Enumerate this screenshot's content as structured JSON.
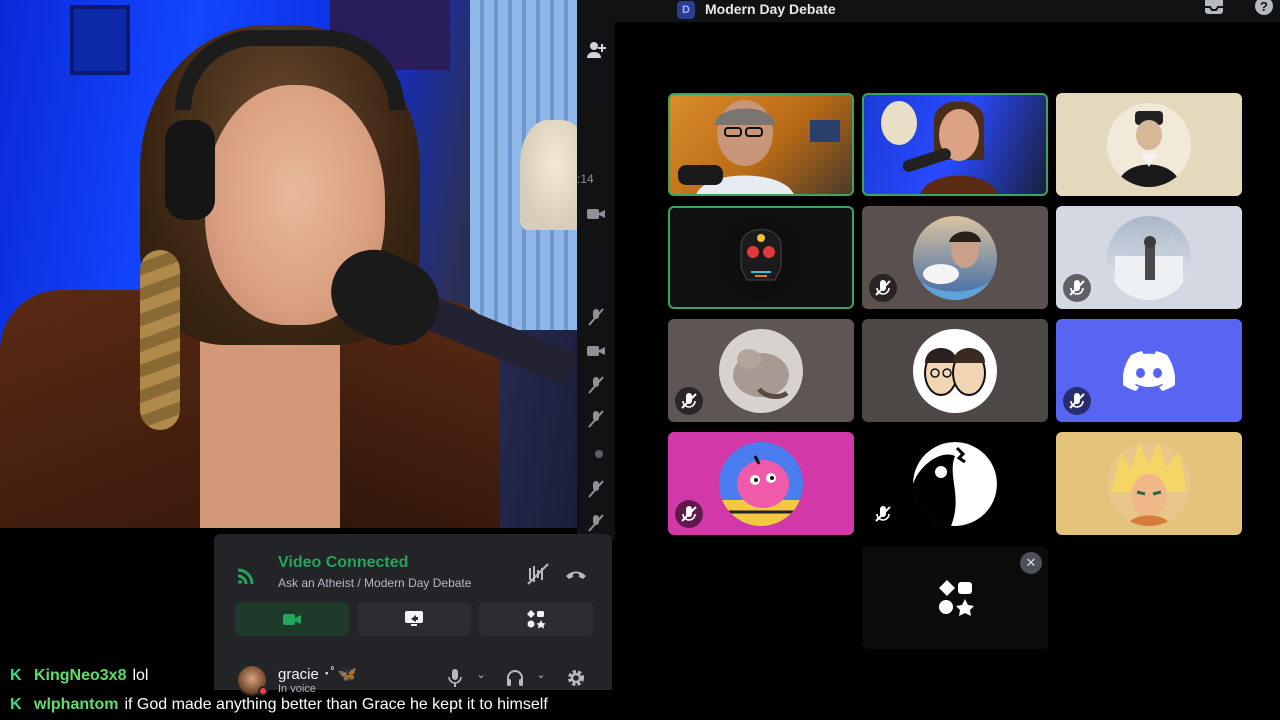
{
  "topbar": {
    "channel_title": "Modern Day Debate",
    "channel_icon": "server-logo-icon",
    "icons": [
      "inbox-icon",
      "help-icon"
    ]
  },
  "rail": {
    "time_fragment": ":14",
    "icons": [
      "add-friend-icon",
      "camera-icon",
      "mic-muted-icon"
    ]
  },
  "voice_panel": {
    "status": "Video Connected",
    "channel": "Ask an Atheist / Modern Day Debate",
    "buttons": [
      "camera-button",
      "screenshare-button",
      "activities-button"
    ]
  },
  "user": {
    "name": "gracie ･ﾟ🦋",
    "sub": "In voice"
  },
  "chat": [
    {
      "badge": "K",
      "user": "KingNeo3x8",
      "message": "lol"
    },
    {
      "badge": "K",
      "user": "wlphantom",
      "message": "if God made anything better than Grace he kept it to himself"
    }
  ],
  "tiles": [
    {
      "kind": "camera-man",
      "speaking": true,
      "muted": false
    },
    {
      "kind": "camera-woman",
      "speaking": true,
      "muted": false
    },
    {
      "kind": "avatar-portrait",
      "speaking": false,
      "muted": false
    },
    {
      "kind": "avatar-skull",
      "speaking": true,
      "muted": false
    },
    {
      "kind": "avatar-actor",
      "speaking": false,
      "muted": true
    },
    {
      "kind": "avatar-snow-figure",
      "speaking": false,
      "muted": true
    },
    {
      "kind": "avatar-cat",
      "speaking": false,
      "muted": true
    },
    {
      "kind": "avatar-cartoon-duo",
      "speaking": false,
      "muted": false
    },
    {
      "kind": "avatar-discord-default",
      "speaking": false,
      "muted": true
    },
    {
      "kind": "avatar-pink-creature",
      "speaking": false,
      "muted": true
    },
    {
      "kind": "avatar-ink-art",
      "speaking": false,
      "muted": true
    },
    {
      "kind": "avatar-anime-hero",
      "speaking": false,
      "muted": false
    }
  ],
  "colors": {
    "connected": "#23a55a",
    "speaking_ring": "#3ba55d",
    "blurple": "#5865f2",
    "chat_user": "#5fdd6c"
  }
}
